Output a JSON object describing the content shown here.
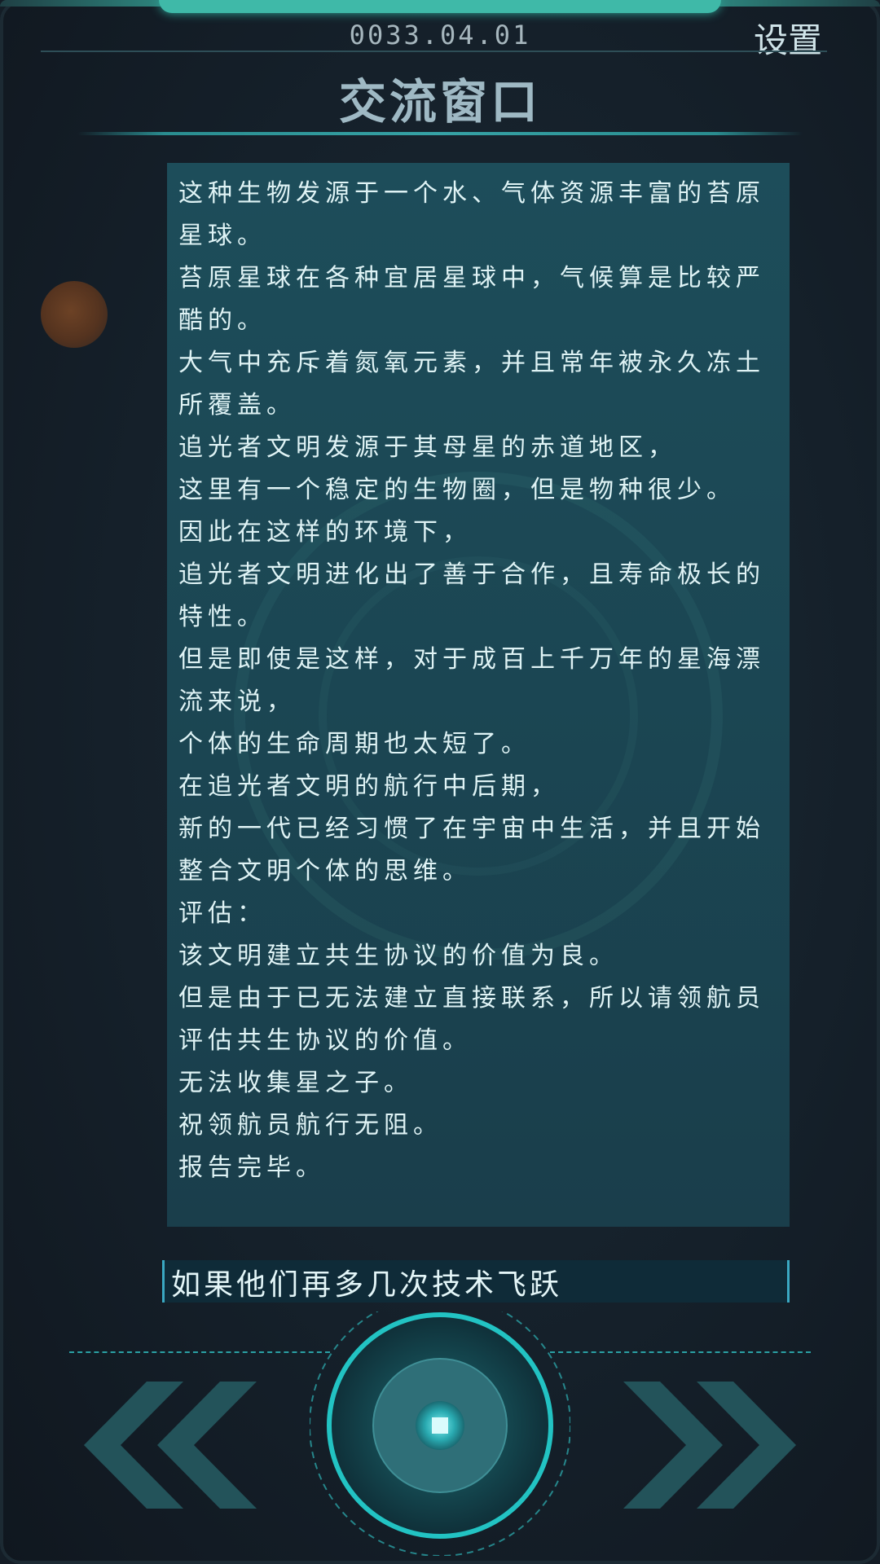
{
  "header": {
    "date": "0033.04.01",
    "settings_label": "设置",
    "title": "交流窗口"
  },
  "message": {
    "lines": [
      "这种生物发源于一个水、气体资源丰富的苔原星球。",
      "苔原星球在各种宜居星球中，气候算是比较严酷的。",
      "大气中充斥着氮氧元素，并且常年被永久冻土所覆盖。",
      "追光者文明发源于其母星的赤道地区，",
      "这里有一个稳定的生物圈，但是物种很少。",
      "因此在这样的环境下，",
      "追光者文明进化出了善于合作，且寿命极长的特性。",
      "但是即使是这样，对于成百上千万年的星海漂流来说，",
      "个体的生命周期也太短了。",
      "在追光者文明的航行中后期，",
      "新的一代已经习惯了在宇宙中生活，并且开始整合文明个体的思维。",
      "评估：",
      "该文明建立共生协议的价值为良。",
      "但是由于已无法建立直接联系，所以请领航员评估共生协议的价值。",
      "无法收集星之子。",
      "祝领航员航行无阻。",
      "报告完毕。"
    ]
  },
  "reply": {
    "text": "如果他们再多几次技术飞跃"
  },
  "controls": {
    "prev_icon": "double-chevron-left-icon",
    "next_icon": "double-chevron-right-icon",
    "center_icon": "square-stop-icon"
  },
  "colors": {
    "accent": "#23b3b5",
    "panel": "#1d4d5a",
    "text": "#dff3f5",
    "chevron": "#23535a"
  }
}
